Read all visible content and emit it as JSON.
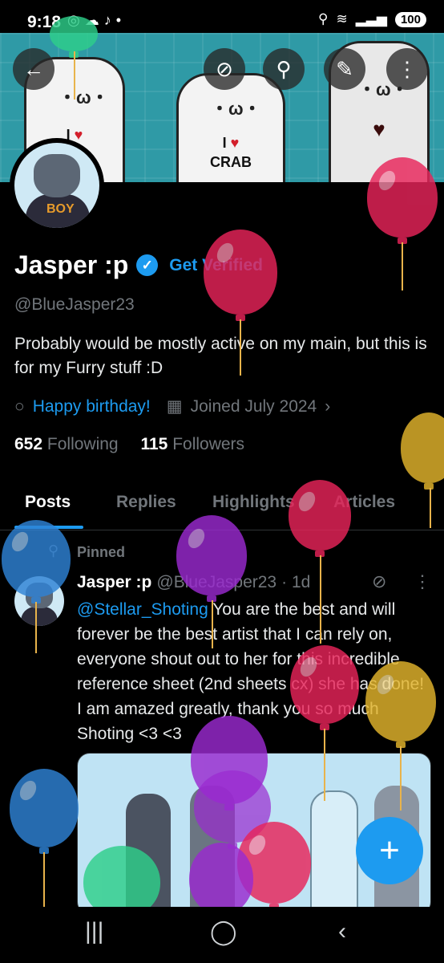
{
  "status_bar": {
    "time": "9:18",
    "battery": "100"
  },
  "profile": {
    "name": "Jasper :p",
    "get_verified": "Get Verified",
    "handle": "@BlueJasper23",
    "bio": "Probably would be mostly active on my main, but this is for my Furry stuff :D",
    "birthday": "Happy birthday!",
    "joined": "Joined July 2024",
    "following_count": "652",
    "following_label": "Following",
    "followers_count": "115",
    "followers_label": "Followers"
  },
  "banner": {
    "shirt_left": "I",
    "shirt_center": "I",
    "crab": "CRAB"
  },
  "tabs": [
    {
      "label": "Posts"
    },
    {
      "label": "Replies"
    },
    {
      "label": "Highlights"
    },
    {
      "label": "Articles"
    }
  ],
  "post": {
    "pinned": "Pinned",
    "author": "Jasper :p",
    "handle": "@BlueJasper23",
    "time": "· 1d",
    "mention": "@Stellar_Shoting",
    "text": " You are the best and will forever be the best artist that I can rely on, everyone shout out to her for this incredible reference sheet (2nd sheets cx) she has done! I am amazed greatly, thank you so much Shoting <3 <3"
  },
  "icons": {
    "back": "back-arrow-icon",
    "grok": "grok-icon",
    "search": "search-icon",
    "edit": "edit-icon",
    "more": "more-vertical-icon",
    "fab": "plus-icon"
  },
  "colors": {
    "accent": "#1d9bf0",
    "background": "#000000",
    "muted": "#71767b"
  }
}
